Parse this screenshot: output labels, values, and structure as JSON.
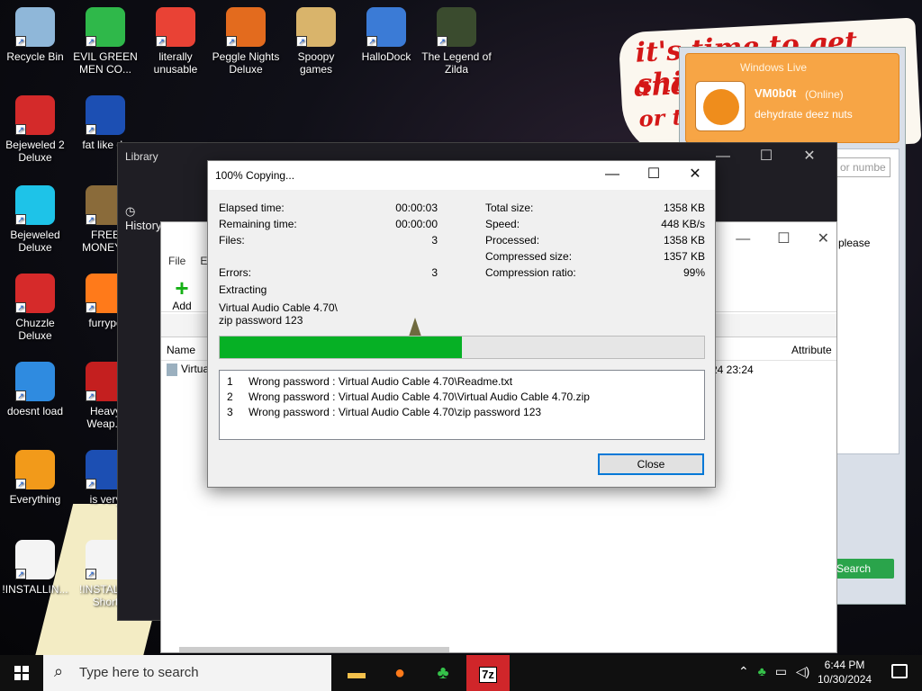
{
  "desktop": {
    "icons": [
      {
        "label": "Recycle Bin",
        "icon": "recycle-bin-icon"
      },
      {
        "label": "EVIL GREEN MEN CO...",
        "icon": "messenger-icon"
      },
      {
        "label": "literally unusable",
        "icon": "chrome-icon"
      },
      {
        "label": "Peggle Nights Deluxe",
        "icon": "peggle-icon"
      },
      {
        "label": "Spoopy games",
        "icon": "folder-icon"
      },
      {
        "label": "HalloDock",
        "icon": "windows-icon"
      },
      {
        "label": "The Legend of Zilda",
        "icon": "zelda-icon"
      },
      {
        "label": "Bejeweled 2 Deluxe",
        "icon": "bejeweled-icon"
      },
      {
        "label": "fat like da",
        "icon": "mpl-icon"
      },
      {
        "label": "Bejeweled Deluxe",
        "icon": "gem-icon"
      },
      {
        "label": "FREE MONEY.c",
        "icon": "money-bag-icon"
      },
      {
        "label": "Chuzzle Deluxe",
        "icon": "chuzzle-icon"
      },
      {
        "label": "furrypo",
        "icon": "firefox-icon"
      },
      {
        "label": "doesnt load",
        "icon": "thunderbird-icon"
      },
      {
        "label": "Heavy Weap...",
        "icon": "radiation-icon"
      },
      {
        "label": "Everything",
        "icon": "magnifier-icon"
      },
      {
        "label": "is very",
        "icon": "mpl-icon"
      },
      {
        "label": "!INSTALLIN...",
        "icon": "document-icon"
      },
      {
        "label": "!INSTALL - Short",
        "icon": "document-icon"
      }
    ],
    "wallpaper_text": [
      "it's time to get shit",
      "and",
      "or t"
    ]
  },
  "library_window": {
    "title": "Library",
    "sidebar": [
      "History"
    ]
  },
  "filemanager": {
    "menu": [
      "File",
      "Ed"
    ],
    "toolbar_add": "Add",
    "columns": {
      "name": "Name",
      "attributes": "Attribute"
    },
    "row_name": "Virtual",
    "row_date": "24 23:24"
  },
  "messenger": {
    "title": "Windows Live",
    "user": "VM0b0t",
    "status": "(Online)",
    "psm": "dehydrate deez nuts",
    "please": "please",
    "search_btn": "Search",
    "number_placeholder": "or numbe"
  },
  "dialog": {
    "title": "100% Copying...",
    "left_stats": [
      {
        "label": "Elapsed time:",
        "value": "00:00:03"
      },
      {
        "label": "Remaining time:",
        "value": "00:00:00"
      },
      {
        "label": "Files:",
        "value": "3"
      },
      {
        "label": "Errors:",
        "value": "3"
      }
    ],
    "right_stats": [
      {
        "label": "Total size:",
        "value": "1358 KB"
      },
      {
        "label": "Speed:",
        "value": "448 KB/s"
      },
      {
        "label": "Processed:",
        "value": "1358 KB"
      },
      {
        "label": "Compressed size:",
        "value": "1357 KB"
      },
      {
        "label": "Compression ratio:",
        "value": "99%"
      }
    ],
    "operation": "Extracting",
    "current_file_line1": "Virtual Audio Cable 4.70\\",
    "current_file_line2": "zip password 123",
    "progress_fraction": 0.5,
    "messages": [
      {
        "n": "1",
        "text": "Wrong password : Virtual Audio Cable 4.70\\Readme.txt"
      },
      {
        "n": "2",
        "text": "Wrong password : Virtual Audio Cable 4.70\\Virtual Audio Cable 4.70.zip"
      },
      {
        "n": "3",
        "text": "Wrong password : Virtual Audio Cable 4.70\\zip password 123"
      }
    ],
    "close_label": "Close"
  },
  "taskbar": {
    "search_placeholder": "Type here to search",
    "apps": [
      "file-explorer-icon",
      "firefox-icon",
      "messenger-icon",
      "7zip-icon"
    ],
    "zip_label": "7z",
    "time": "6:44 PM",
    "date": "10/30/2024"
  },
  "colors": {
    "progress": "#06b025",
    "accent": "#0078d7",
    "active_taskbar": "#d0262a"
  }
}
